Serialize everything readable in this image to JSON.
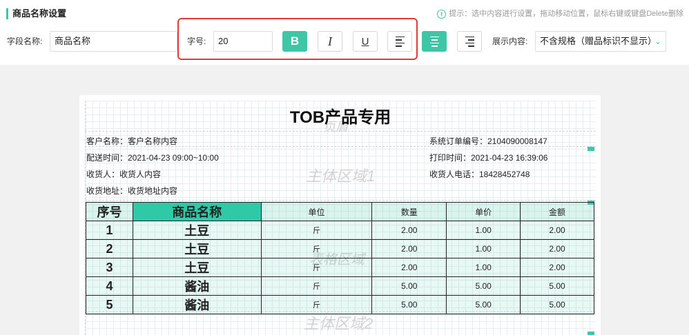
{
  "panel": {
    "title": "商品名称设置",
    "hint": "提示：选中内容进行设置，拖动移动位置，鼠标右键或键盘Delete删除"
  },
  "form": {
    "field_label": "字段名称:",
    "field_value": "商品名称",
    "size_label": "字号:",
    "size_value": "20",
    "bold_glyph": "B",
    "italic_glyph": "I",
    "underline_glyph": "U",
    "display_label": "展示内容:",
    "display_value": "不含规格（赠品标识不显示）"
  },
  "colors": {
    "accent": "#3ec6a6",
    "highlight_box": "#e53935"
  },
  "document": {
    "title": "TOB产品专用",
    "header_region": "页眉",
    "body_region_1": "主体区域1",
    "table_region": "表格区域",
    "body_region_2": "主体区域2",
    "fields": {
      "customer": "客户名称：客户名称内容",
      "order_no": "系统订单编号：2104090008147",
      "delivery": "配送时间：2021-04-23 09:00~10:00",
      "print_time": "打印时间：2021-04-23 16:39:06",
      "receiver": "收货人：收货人内容",
      "receiver_phone": "收货人电话：18428452748",
      "address": "收货地址：收货地址内容"
    },
    "table": {
      "headers": [
        "序号",
        "商品名称",
        "单位",
        "数量",
        "单价",
        "金额"
      ],
      "rows": [
        [
          "1",
          "土豆",
          "斤",
          "2.00",
          "1.00",
          "2.00"
        ],
        [
          "2",
          "土豆",
          "斤",
          "2.00",
          "1.00",
          "2.00"
        ],
        [
          "3",
          "土豆",
          "斤",
          "2.00",
          "1.00",
          "2.00"
        ],
        [
          "4",
          "酱油",
          "斤",
          "5.00",
          "5.00",
          "5.00"
        ],
        [
          "5",
          "酱油",
          "斤",
          "5.00",
          "5.00",
          "5.00"
        ]
      ]
    }
  }
}
